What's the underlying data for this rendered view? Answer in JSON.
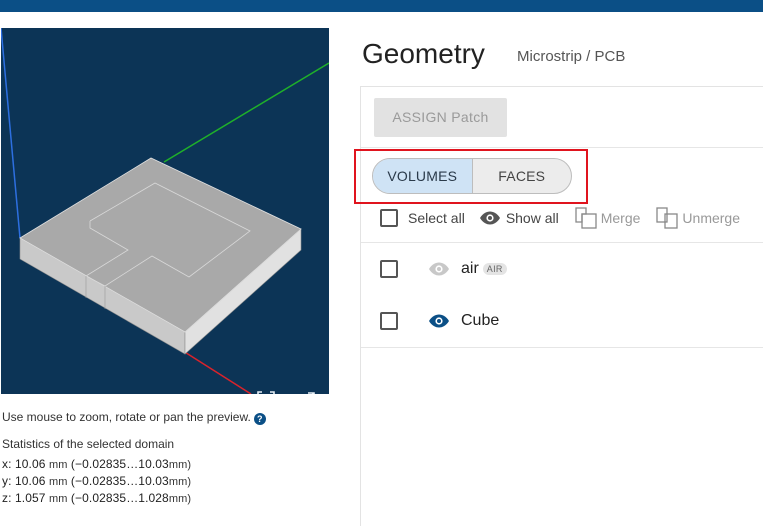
{
  "colors": {
    "topbar": "#0b4f86",
    "viewport_bg": "#0c3456",
    "accent": "#0b4f86",
    "highlight": "#e0141e",
    "toggle_active": "#cfe3f5"
  },
  "viewport": {
    "fit_icon": "focus-fit-icon",
    "fullscreen_icon": "expand-arrows-icon"
  },
  "hint": {
    "text": "Use mouse to zoom, rotate or pan the preview.",
    "help_icon": "question-circle-icon",
    "help_glyph": "?"
  },
  "statistics": {
    "title": "Statistics of the selected domain",
    "rows": [
      {
        "axis": "x",
        "size": "10.06",
        "size_unit": "mm",
        "range": "(−0.02835…10.03",
        "range_unit": "mm)"
      },
      {
        "axis": "y",
        "size": "10.06",
        "size_unit": "mm",
        "range": "(−0.02835…10.03",
        "range_unit": "mm)"
      },
      {
        "axis": "z",
        "size": "1.057",
        "size_unit": "mm",
        "range": "(−0.02835…1.028",
        "range_unit": "mm)"
      }
    ]
  },
  "header": {
    "title": "Geometry",
    "subtitle": "Microstrip / PCB"
  },
  "panel": {
    "assign_button": "ASSIGN Patch",
    "toggle": {
      "volumes": "VOLUMES",
      "faces": "FACES",
      "active": "volumes"
    },
    "actions": {
      "select_all": "Select all",
      "show_all": "Show all",
      "merge": "Merge",
      "unmerge": "Unmerge"
    },
    "items": [
      {
        "name": "air",
        "badge": "AIR",
        "visible": false
      },
      {
        "name": "Cube",
        "badge": "",
        "visible": true
      }
    ]
  }
}
